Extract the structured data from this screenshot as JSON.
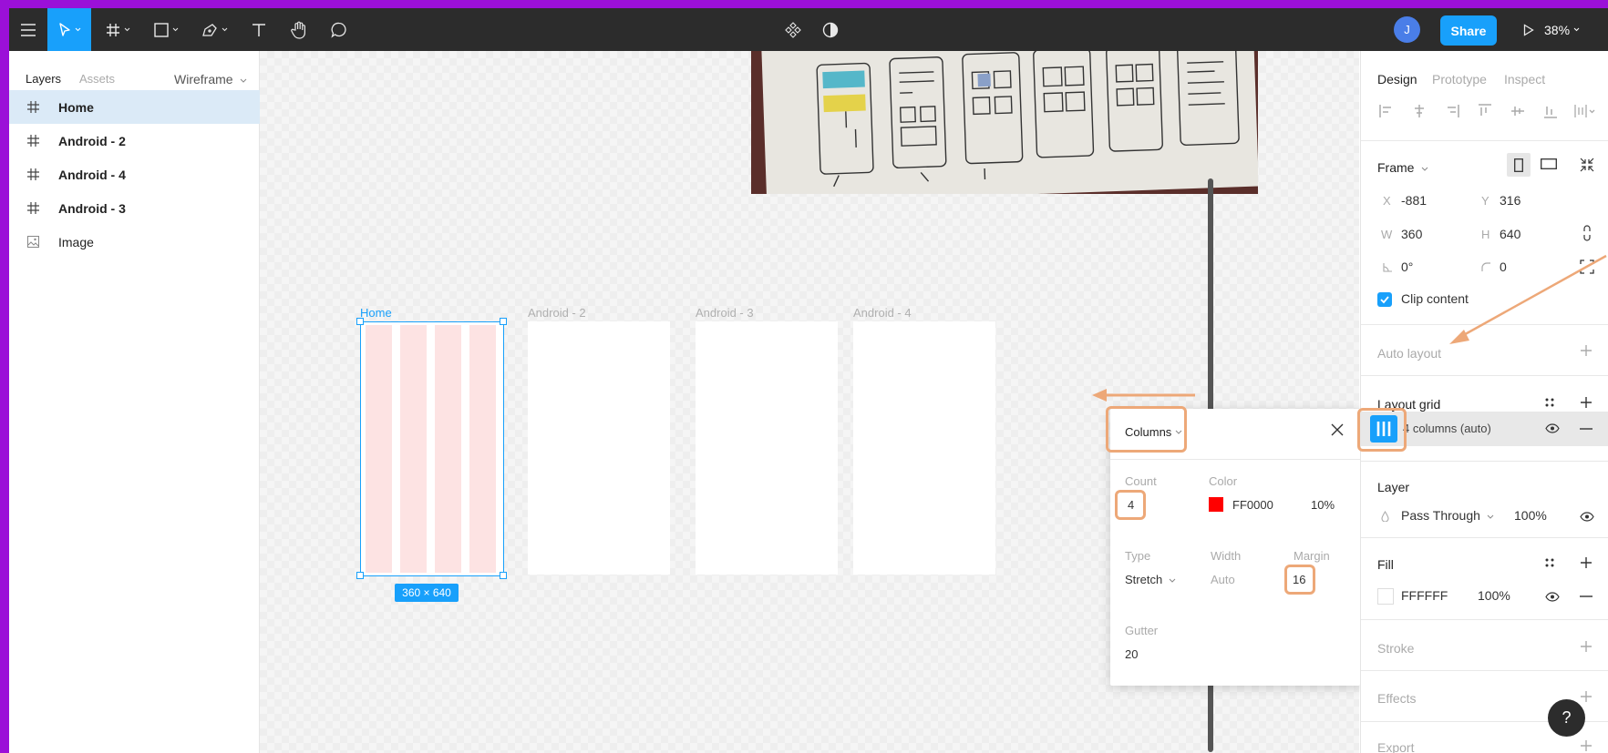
{
  "toolbar": {
    "menu_icon": "hamburger-icon",
    "tools": [
      "move-tool",
      "frame-tool",
      "shape-tool",
      "pen-tool",
      "text-tool",
      "hand-tool",
      "comment-tool"
    ],
    "avatar_initial": "J",
    "share_label": "Share",
    "zoom_label": "38%"
  },
  "left_panel": {
    "tabs": [
      {
        "label": "Layers"
      },
      {
        "label": "Assets"
      }
    ],
    "page_label": "Wireframe",
    "layers": [
      {
        "label": "Home",
        "icon": "frame-hash-icon",
        "selected": true
      },
      {
        "label": "Android - 2",
        "icon": "frame-hash-icon"
      },
      {
        "label": "Android - 4",
        "icon": "frame-hash-icon"
      },
      {
        "label": "Android - 3",
        "icon": "frame-hash-icon"
      },
      {
        "label": "Image",
        "icon": "image-icon"
      }
    ]
  },
  "canvas": {
    "frames": [
      {
        "label": "Home"
      },
      {
        "label": "Android - 2"
      },
      {
        "label": "Android - 3"
      },
      {
        "label": "Android - 4"
      }
    ],
    "size_badge": "360 × 640",
    "grid_color": "#fde3e3"
  },
  "grid_popover": {
    "type_select": "Columns",
    "count_label": "Count",
    "count_value": "4",
    "color_label": "Color",
    "color_hex": "FF0000",
    "color_opacity": "10%",
    "type_label": "Type",
    "type_value": "Stretch",
    "width_label": "Width",
    "width_value": "Auto",
    "margin_label": "Margin",
    "margin_value": "16",
    "gutter_label": "Gutter",
    "gutter_value": "20"
  },
  "right_panel": {
    "tabs": [
      {
        "label": "Design"
      },
      {
        "label": "Prototype"
      },
      {
        "label": "Inspect"
      }
    ],
    "frame_section": {
      "title": "Frame",
      "x_label": "X",
      "x_value": "-881",
      "y_label": "Y",
      "y_value": "316",
      "w_label": "W",
      "w_value": "360",
      "h_label": "H",
      "h_value": "640",
      "rotation_value": "0°",
      "radius_value": "0",
      "clip_label": "Clip content"
    },
    "auto_layout_title": "Auto layout",
    "layout_grid_title": "Layout grid",
    "layout_grid_item": "4 columns (auto)",
    "layer_title": "Layer",
    "blend_mode": "Pass Through",
    "layer_opacity": "100%",
    "fill_title": "Fill",
    "fill_hex": "FFFFFF",
    "fill_opacity": "100%",
    "stroke_title": "Stroke",
    "effects_title": "Effects",
    "export_title": "Export"
  },
  "help_label": "?",
  "accent_color": "#18a0fb",
  "annotation_color": "#eda878"
}
